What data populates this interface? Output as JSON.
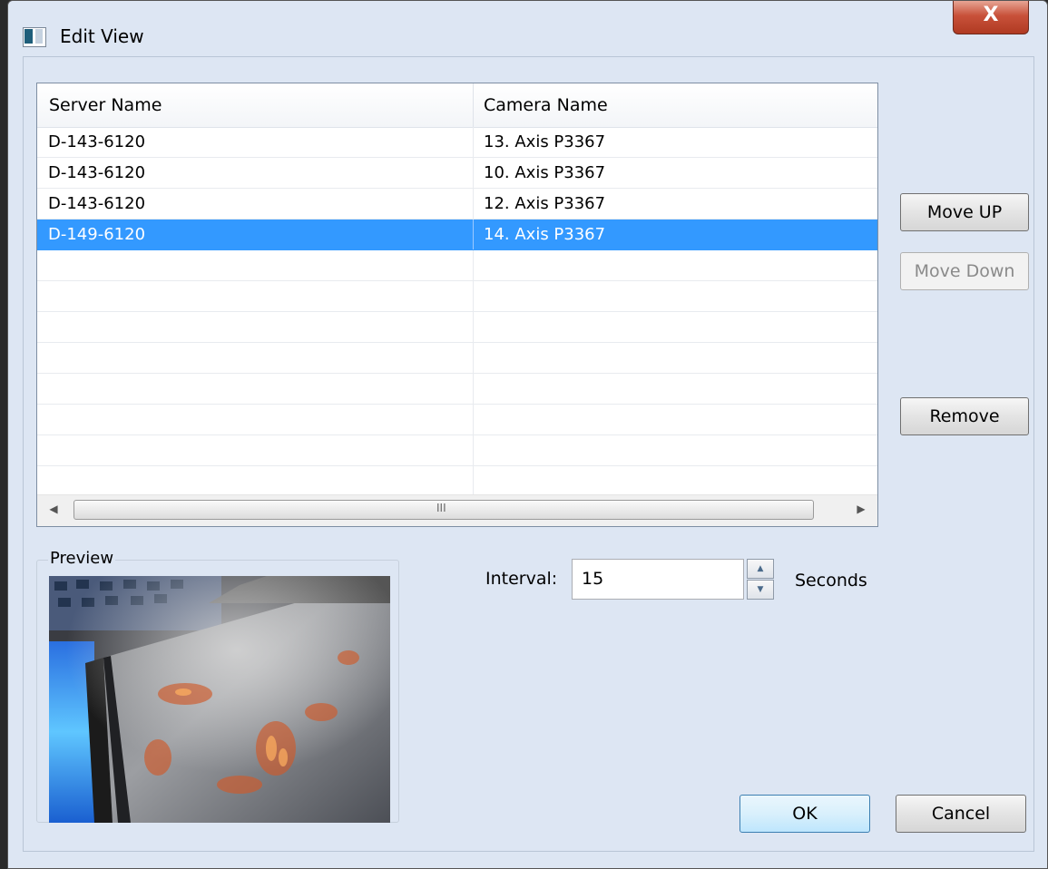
{
  "window": {
    "title": "Edit View",
    "close_glyph": "X"
  },
  "listview": {
    "columns": [
      "Server Name",
      "Camera Name"
    ],
    "rows": [
      {
        "server": "D-143-6120",
        "camera": "13. Axis P3367",
        "selected": false
      },
      {
        "server": "D-143-6120",
        "camera": "10. Axis P3367",
        "selected": false
      },
      {
        "server": "D-143-6120",
        "camera": "12. Axis P3367",
        "selected": false
      },
      {
        "server": "D-149-6120",
        "camera": "14. Axis P3367",
        "selected": true
      }
    ],
    "scroll_grip": "III"
  },
  "buttons": {
    "move_up": "Move UP",
    "move_down": "Move Down",
    "remove": "Remove",
    "ok": "OK",
    "cancel": "Cancel"
  },
  "preview": {
    "label": "Preview"
  },
  "interval": {
    "label": "Interval:",
    "value": "15",
    "unit": "Seconds"
  },
  "colors": {
    "selection": "#3399ff",
    "dialog_bg": "#dde6f3"
  }
}
